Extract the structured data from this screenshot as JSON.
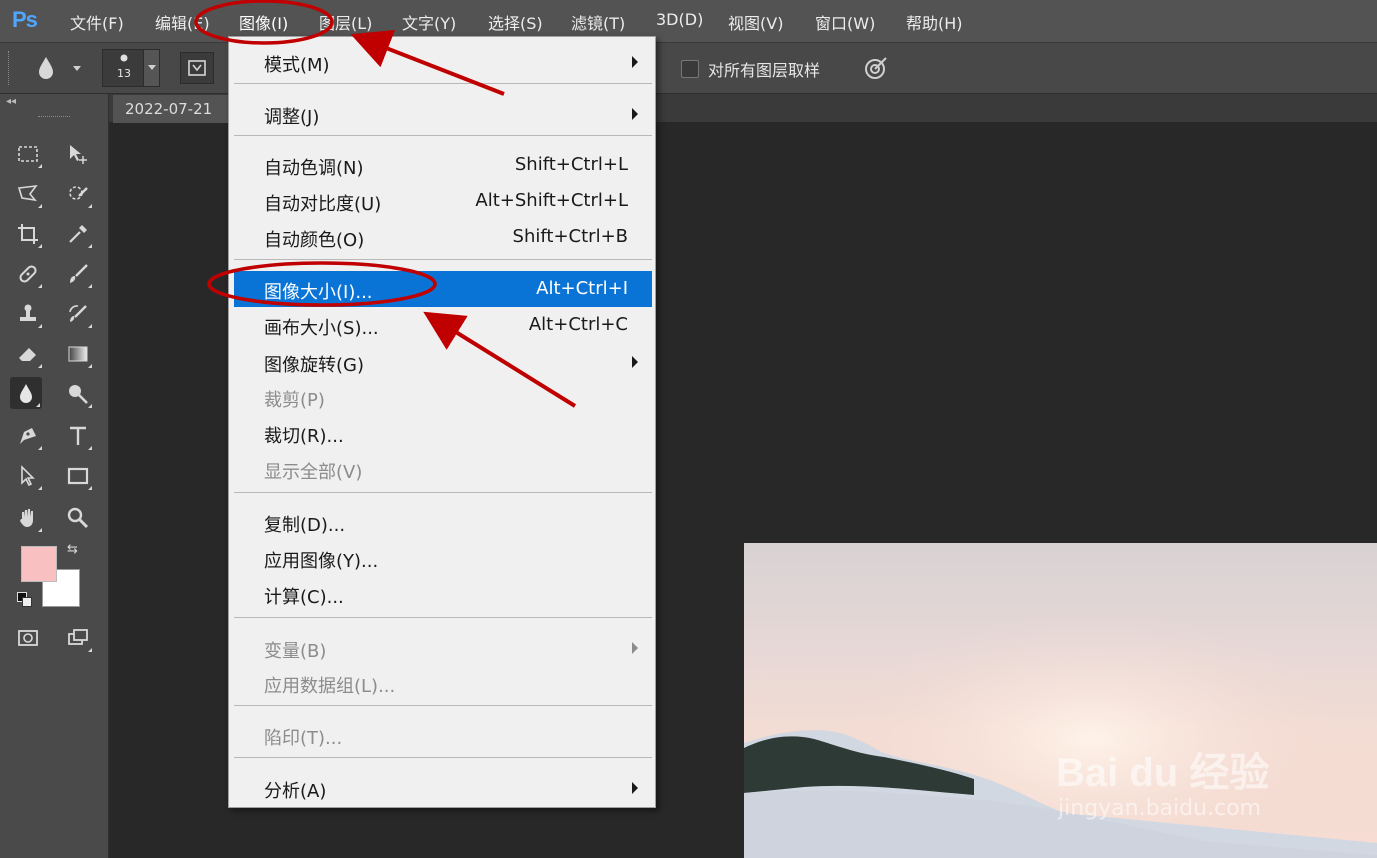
{
  "app": {
    "logo": "Ps",
    "menu": [
      {
        "label": "文件(F)",
        "name": "menu-file"
      },
      {
        "label": "编辑(E)",
        "name": "menu-edit"
      },
      {
        "label": "图像(I)",
        "name": "menu-image"
      },
      {
        "label": "图层(L)",
        "name": "menu-layer"
      },
      {
        "label": "文字(Y)",
        "name": "menu-type"
      },
      {
        "label": "选择(S)",
        "name": "menu-select"
      },
      {
        "label": "滤镜(T)",
        "name": "menu-filter"
      },
      {
        "label": "3D(D)",
        "name": "menu-3d"
      },
      {
        "label": "视图(V)",
        "name": "menu-view"
      },
      {
        "label": "窗口(W)",
        "name": "menu-window"
      },
      {
        "label": "帮助(H)",
        "name": "menu-help"
      }
    ]
  },
  "options_bar": {
    "brush_size": "13",
    "sample_all_layers": "对所有图层取样",
    "sample_all_checked": false
  },
  "document": {
    "tab_title": "2022-07-21"
  },
  "colors": {
    "foreground": "#f8c0c0",
    "background": "#ffffff",
    "highlight": "#0a74d6",
    "annotation": "#c00000"
  },
  "tools": [
    "rectangular-marquee-icon",
    "move-icon",
    "polygonal-lasso-icon",
    "quick-selection-icon",
    "crop-icon",
    "eyedropper-icon",
    "spot-healing-icon",
    "brush-icon",
    "clone-stamp-icon",
    "history-brush-icon",
    "eraser-icon",
    "gradient-icon",
    "blur-icon",
    "dodge-icon",
    "pen-icon",
    "type-icon",
    "path-selection-icon",
    "rectangle-shape-icon",
    "hand-icon",
    "zoom-icon"
  ],
  "dropdown": {
    "items": [
      {
        "label": "模式(M)",
        "shortcut": "",
        "submenu": true,
        "disabled": false
      },
      {
        "label": "调整(J)",
        "shortcut": "",
        "submenu": true,
        "disabled": false
      },
      {
        "label": "自动色调(N)",
        "shortcut": "Shift+Ctrl+L",
        "submenu": false,
        "disabled": false
      },
      {
        "label": "自动对比度(U)",
        "shortcut": "Alt+Shift+Ctrl+L",
        "submenu": false,
        "disabled": false
      },
      {
        "label": "自动颜色(O)",
        "shortcut": "Shift+Ctrl+B",
        "submenu": false,
        "disabled": false
      },
      {
        "label": "图像大小(I)...",
        "shortcut": "Alt+Ctrl+I",
        "submenu": false,
        "disabled": false,
        "highlighted": true
      },
      {
        "label": "画布大小(S)...",
        "shortcut": "Alt+Ctrl+C",
        "submenu": false,
        "disabled": false
      },
      {
        "label": "图像旋转(G)",
        "shortcut": "",
        "submenu": true,
        "disabled": false
      },
      {
        "label": "裁剪(P)",
        "shortcut": "",
        "submenu": false,
        "disabled": true
      },
      {
        "label": "裁切(R)...",
        "shortcut": "",
        "submenu": false,
        "disabled": false
      },
      {
        "label": "显示全部(V)",
        "shortcut": "",
        "submenu": false,
        "disabled": true
      },
      {
        "label": "复制(D)...",
        "shortcut": "",
        "submenu": false,
        "disabled": false
      },
      {
        "label": "应用图像(Y)...",
        "shortcut": "",
        "submenu": false,
        "disabled": false
      },
      {
        "label": "计算(C)...",
        "shortcut": "",
        "submenu": false,
        "disabled": false
      },
      {
        "label": "变量(B)",
        "shortcut": "",
        "submenu": true,
        "disabled": true
      },
      {
        "label": "应用数据组(L)...",
        "shortcut": "",
        "submenu": false,
        "disabled": true
      },
      {
        "label": "陷印(T)...",
        "shortcut": "",
        "submenu": false,
        "disabled": true
      },
      {
        "label": "分析(A)",
        "shortcut": "",
        "submenu": true,
        "disabled": false
      }
    ]
  },
  "watermark": {
    "text": "Bai du 经验",
    "url": "jingyan.baidu.com"
  }
}
